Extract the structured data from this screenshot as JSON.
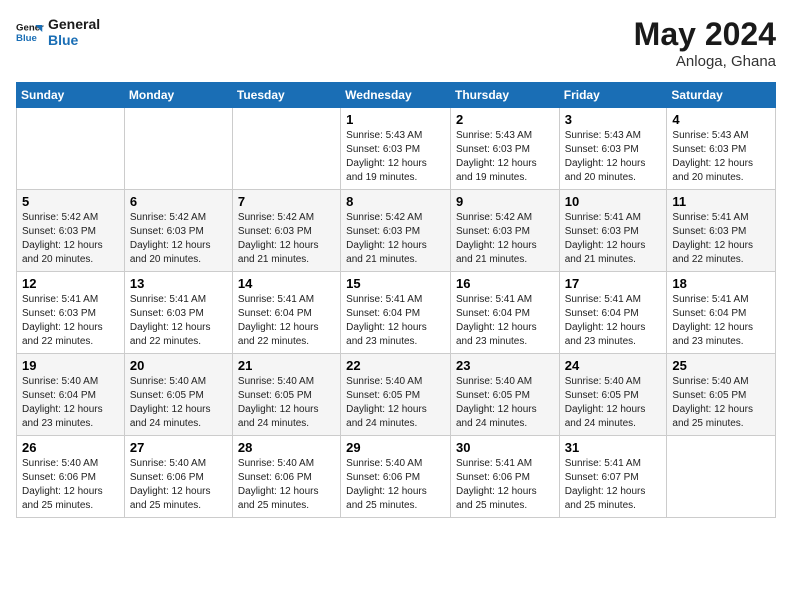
{
  "header": {
    "logo_general": "General",
    "logo_blue": "Blue",
    "month": "May 2024",
    "location": "Anloga, Ghana"
  },
  "weekdays": [
    "Sunday",
    "Monday",
    "Tuesday",
    "Wednesday",
    "Thursday",
    "Friday",
    "Saturday"
  ],
  "weeks": [
    [
      {
        "day": "",
        "info": ""
      },
      {
        "day": "",
        "info": ""
      },
      {
        "day": "",
        "info": ""
      },
      {
        "day": "1",
        "info": "Sunrise: 5:43 AM\nSunset: 6:03 PM\nDaylight: 12 hours\nand 19 minutes."
      },
      {
        "day": "2",
        "info": "Sunrise: 5:43 AM\nSunset: 6:03 PM\nDaylight: 12 hours\nand 19 minutes."
      },
      {
        "day": "3",
        "info": "Sunrise: 5:43 AM\nSunset: 6:03 PM\nDaylight: 12 hours\nand 20 minutes."
      },
      {
        "day": "4",
        "info": "Sunrise: 5:43 AM\nSunset: 6:03 PM\nDaylight: 12 hours\nand 20 minutes."
      }
    ],
    [
      {
        "day": "5",
        "info": "Sunrise: 5:42 AM\nSunset: 6:03 PM\nDaylight: 12 hours\nand 20 minutes."
      },
      {
        "day": "6",
        "info": "Sunrise: 5:42 AM\nSunset: 6:03 PM\nDaylight: 12 hours\nand 20 minutes."
      },
      {
        "day": "7",
        "info": "Sunrise: 5:42 AM\nSunset: 6:03 PM\nDaylight: 12 hours\nand 21 minutes."
      },
      {
        "day": "8",
        "info": "Sunrise: 5:42 AM\nSunset: 6:03 PM\nDaylight: 12 hours\nand 21 minutes."
      },
      {
        "day": "9",
        "info": "Sunrise: 5:42 AM\nSunset: 6:03 PM\nDaylight: 12 hours\nand 21 minutes."
      },
      {
        "day": "10",
        "info": "Sunrise: 5:41 AM\nSunset: 6:03 PM\nDaylight: 12 hours\nand 21 minutes."
      },
      {
        "day": "11",
        "info": "Sunrise: 5:41 AM\nSunset: 6:03 PM\nDaylight: 12 hours\nand 22 minutes."
      }
    ],
    [
      {
        "day": "12",
        "info": "Sunrise: 5:41 AM\nSunset: 6:03 PM\nDaylight: 12 hours\nand 22 minutes."
      },
      {
        "day": "13",
        "info": "Sunrise: 5:41 AM\nSunset: 6:03 PM\nDaylight: 12 hours\nand 22 minutes."
      },
      {
        "day": "14",
        "info": "Sunrise: 5:41 AM\nSunset: 6:04 PM\nDaylight: 12 hours\nand 22 minutes."
      },
      {
        "day": "15",
        "info": "Sunrise: 5:41 AM\nSunset: 6:04 PM\nDaylight: 12 hours\nand 23 minutes."
      },
      {
        "day": "16",
        "info": "Sunrise: 5:41 AM\nSunset: 6:04 PM\nDaylight: 12 hours\nand 23 minutes."
      },
      {
        "day": "17",
        "info": "Sunrise: 5:41 AM\nSunset: 6:04 PM\nDaylight: 12 hours\nand 23 minutes."
      },
      {
        "day": "18",
        "info": "Sunrise: 5:41 AM\nSunset: 6:04 PM\nDaylight: 12 hours\nand 23 minutes."
      }
    ],
    [
      {
        "day": "19",
        "info": "Sunrise: 5:40 AM\nSunset: 6:04 PM\nDaylight: 12 hours\nand 23 minutes."
      },
      {
        "day": "20",
        "info": "Sunrise: 5:40 AM\nSunset: 6:05 PM\nDaylight: 12 hours\nand 24 minutes."
      },
      {
        "day": "21",
        "info": "Sunrise: 5:40 AM\nSunset: 6:05 PM\nDaylight: 12 hours\nand 24 minutes."
      },
      {
        "day": "22",
        "info": "Sunrise: 5:40 AM\nSunset: 6:05 PM\nDaylight: 12 hours\nand 24 minutes."
      },
      {
        "day": "23",
        "info": "Sunrise: 5:40 AM\nSunset: 6:05 PM\nDaylight: 12 hours\nand 24 minutes."
      },
      {
        "day": "24",
        "info": "Sunrise: 5:40 AM\nSunset: 6:05 PM\nDaylight: 12 hours\nand 24 minutes."
      },
      {
        "day": "25",
        "info": "Sunrise: 5:40 AM\nSunset: 6:05 PM\nDaylight: 12 hours\nand 25 minutes."
      }
    ],
    [
      {
        "day": "26",
        "info": "Sunrise: 5:40 AM\nSunset: 6:06 PM\nDaylight: 12 hours\nand 25 minutes."
      },
      {
        "day": "27",
        "info": "Sunrise: 5:40 AM\nSunset: 6:06 PM\nDaylight: 12 hours\nand 25 minutes."
      },
      {
        "day": "28",
        "info": "Sunrise: 5:40 AM\nSunset: 6:06 PM\nDaylight: 12 hours\nand 25 minutes."
      },
      {
        "day": "29",
        "info": "Sunrise: 5:40 AM\nSunset: 6:06 PM\nDaylight: 12 hours\nand 25 minutes."
      },
      {
        "day": "30",
        "info": "Sunrise: 5:41 AM\nSunset: 6:06 PM\nDaylight: 12 hours\nand 25 minutes."
      },
      {
        "day": "31",
        "info": "Sunrise: 5:41 AM\nSunset: 6:07 PM\nDaylight: 12 hours\nand 25 minutes."
      },
      {
        "day": "",
        "info": ""
      }
    ]
  ]
}
